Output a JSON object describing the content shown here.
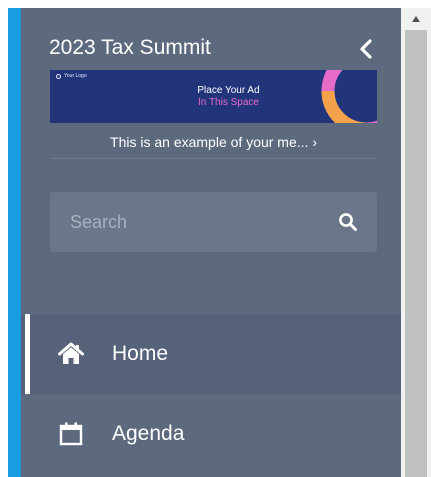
{
  "sidebar": {
    "event_title": "2023 Tax Summit",
    "collapse_icon": "chevron-left-icon",
    "ad": {
      "logo_text": "Your Logo",
      "line1": "Place Your Ad",
      "line2": "In This Space",
      "caption": "This is an example of your me... ›"
    },
    "search": {
      "placeholder": "Search",
      "value": "",
      "icon": "search-icon"
    },
    "nav": {
      "items": [
        {
          "label": "Home",
          "icon": "home-icon",
          "active": true
        },
        {
          "label": "Agenda",
          "icon": "calendar-icon",
          "active": false
        }
      ]
    }
  },
  "colors": {
    "accent": "#1a9ce0",
    "sidebar_bg": "#5d6a7e",
    "active_item_bg": "#56627a",
    "ad_bg": "#22347a",
    "ad_highlight": "#e76cc9"
  }
}
